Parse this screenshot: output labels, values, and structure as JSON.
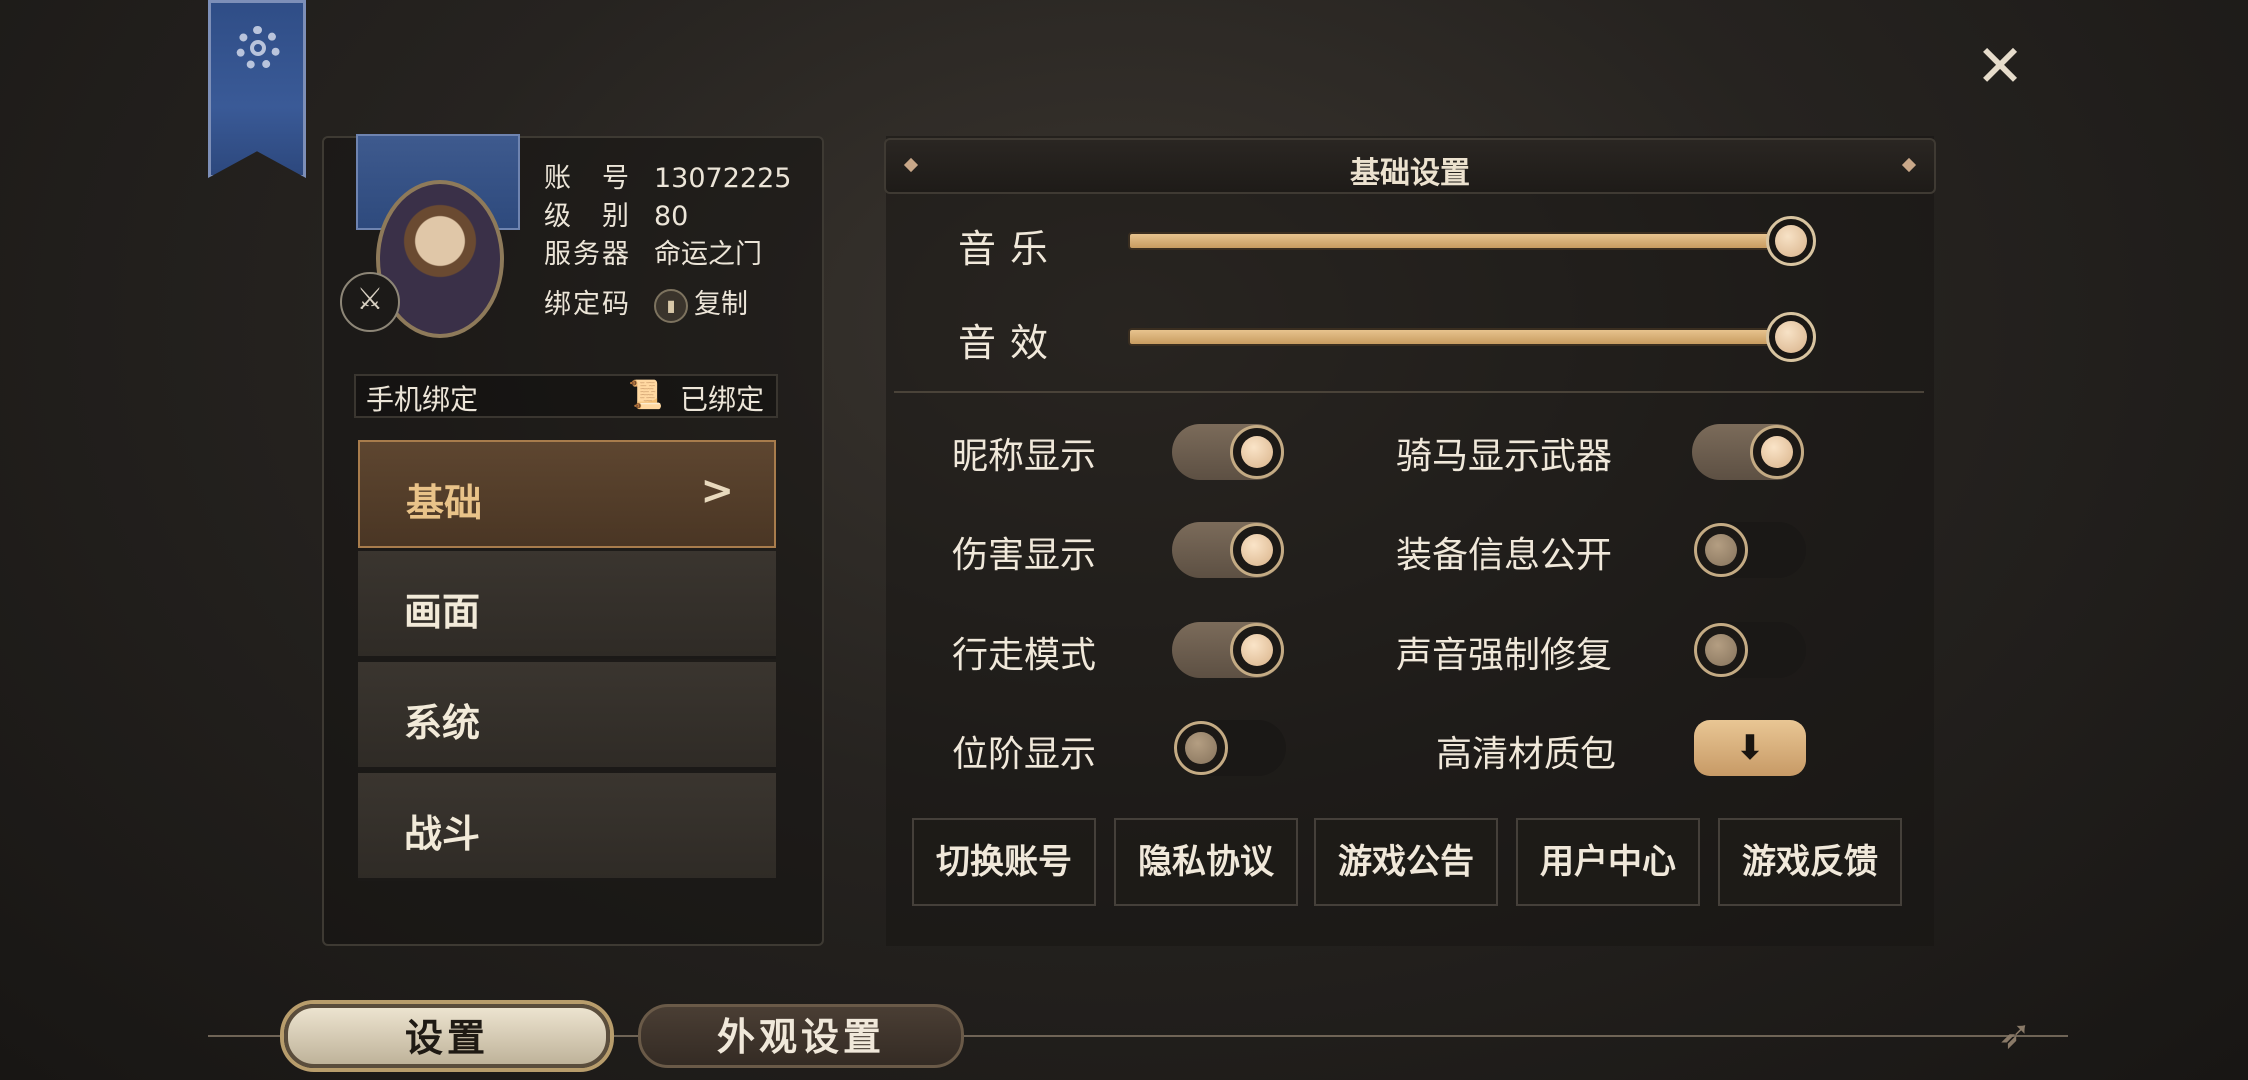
{
  "profile": {
    "account_label": "账　号",
    "account_value": "13072225",
    "level_label": "级　别",
    "level_value": "80",
    "server_label": "服务器",
    "server_value": "命运之门",
    "bind_code_label": "绑定码",
    "copy_label": "复制"
  },
  "phone": {
    "label": "手机绑定",
    "status": "已绑定"
  },
  "menu": {
    "items": [
      {
        "label": "基础",
        "active": true
      },
      {
        "label": "画面",
        "active": false
      },
      {
        "label": "系统",
        "active": false
      },
      {
        "label": "战斗",
        "active": false
      }
    ]
  },
  "section": {
    "title": "基础设置"
  },
  "sliders": [
    {
      "label": "音乐",
      "value_percent": 100
    },
    {
      "label": "音效",
      "value_percent": 100
    }
  ],
  "toggles": [
    {
      "label": "昵称显示",
      "on": true
    },
    {
      "label": "骑马显示武器",
      "on": true
    },
    {
      "label": "伤害显示",
      "on": true
    },
    {
      "label": "装备信息公开",
      "on": false
    },
    {
      "label": "行走模式",
      "on": true
    },
    {
      "label": "声音强制修复",
      "on": false
    },
    {
      "label": "位阶显示",
      "on": false
    },
    {
      "label": "高清材质包",
      "download": true
    }
  ],
  "download_icon": "⬇",
  "actions": [
    "切换账号",
    "隐私协议",
    "游戏公告",
    "用户中心",
    "游戏反馈"
  ],
  "bottom_tabs": [
    "设置",
    "外观设置"
  ],
  "close_icon": "✕",
  "colors": {
    "accent_gold": "#e9c389",
    "banner_blue": "#3a5a97",
    "slider_fill": "#e7c38e"
  }
}
